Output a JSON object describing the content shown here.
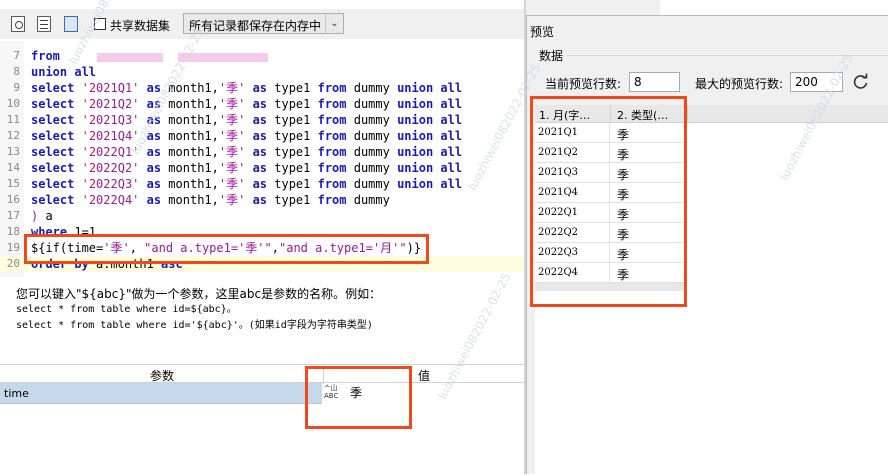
{
  "toolbar": {
    "share_label": "共享数据集",
    "storage_mode": "所有记录都保存在内存中"
  },
  "editor": {
    "lines": [
      {
        "n": "7",
        "parts": [
          [
            "kw",
            "from"
          ],
          [
            "pl",
            " "
          ]
        ]
      },
      {
        "n": "8",
        "parts": [
          [
            "kw",
            "union"
          ],
          [
            "pl",
            " "
          ],
          [
            "kw",
            "all"
          ]
        ]
      },
      {
        "n": "9",
        "parts": [
          [
            "kw",
            "select"
          ],
          [
            "pl",
            " "
          ],
          [
            "str",
            "'2021Q1'"
          ],
          [
            "pl",
            " "
          ],
          [
            "kw",
            "as"
          ],
          [
            "pl",
            " month1,"
          ],
          [
            "str",
            "'季'"
          ],
          [
            "pl",
            " "
          ],
          [
            "kw",
            "as"
          ],
          [
            "pl",
            " type1 "
          ],
          [
            "kw",
            "from"
          ],
          [
            "pl",
            " dummy "
          ],
          [
            "kw",
            "union all"
          ]
        ]
      },
      {
        "n": "10",
        "parts": [
          [
            "kw",
            "select"
          ],
          [
            "pl",
            " "
          ],
          [
            "str",
            "'2021Q2'"
          ],
          [
            "pl",
            " "
          ],
          [
            "kw",
            "as"
          ],
          [
            "pl",
            " month1,"
          ],
          [
            "str",
            "'季'"
          ],
          [
            "pl",
            " "
          ],
          [
            "kw",
            "as"
          ],
          [
            "pl",
            " type1 "
          ],
          [
            "kw",
            "from"
          ],
          [
            "pl",
            " dummy "
          ],
          [
            "kw",
            "union all"
          ]
        ]
      },
      {
        "n": "11",
        "parts": [
          [
            "kw",
            "select"
          ],
          [
            "pl",
            " "
          ],
          [
            "str",
            "'2021Q3'"
          ],
          [
            "pl",
            " "
          ],
          [
            "kw",
            "as"
          ],
          [
            "pl",
            " month1,"
          ],
          [
            "str",
            "'季'"
          ],
          [
            "pl",
            " "
          ],
          [
            "kw",
            "as"
          ],
          [
            "pl",
            " type1 "
          ],
          [
            "kw",
            "from"
          ],
          [
            "pl",
            " dummy "
          ],
          [
            "kw",
            "union all"
          ]
        ]
      },
      {
        "n": "12",
        "parts": [
          [
            "kw",
            "select"
          ],
          [
            "pl",
            " "
          ],
          [
            "str",
            "'2021Q4'"
          ],
          [
            "pl",
            " "
          ],
          [
            "kw",
            "as"
          ],
          [
            "pl",
            " month1,"
          ],
          [
            "str",
            "'季'"
          ],
          [
            "pl",
            " "
          ],
          [
            "kw",
            "as"
          ],
          [
            "pl",
            " type1 "
          ],
          [
            "kw",
            "from"
          ],
          [
            "pl",
            " dummy "
          ],
          [
            "kw",
            "union all"
          ]
        ]
      },
      {
        "n": "13",
        "parts": [
          [
            "kw",
            "select"
          ],
          [
            "pl",
            " "
          ],
          [
            "str",
            "'2022Q1'"
          ],
          [
            "pl",
            " "
          ],
          [
            "kw",
            "as"
          ],
          [
            "pl",
            " month1,"
          ],
          [
            "str",
            "'季'"
          ],
          [
            "pl",
            " "
          ],
          [
            "kw",
            "as"
          ],
          [
            "pl",
            " type1 "
          ],
          [
            "kw",
            "from"
          ],
          [
            "pl",
            " dummy "
          ],
          [
            "kw",
            "union all"
          ]
        ]
      },
      {
        "n": "14",
        "parts": [
          [
            "kw",
            "select"
          ],
          [
            "pl",
            " "
          ],
          [
            "str",
            "'2022Q2'"
          ],
          [
            "pl",
            " "
          ],
          [
            "kw",
            "as"
          ],
          [
            "pl",
            " month1,"
          ],
          [
            "str",
            "'季'"
          ],
          [
            "pl",
            " "
          ],
          [
            "kw",
            "as"
          ],
          [
            "pl",
            " type1 "
          ],
          [
            "kw",
            "from"
          ],
          [
            "pl",
            " dummy "
          ],
          [
            "kw",
            "union all"
          ]
        ]
      },
      {
        "n": "15",
        "parts": [
          [
            "kw",
            "select"
          ],
          [
            "pl",
            " "
          ],
          [
            "str",
            "'2022Q3'"
          ],
          [
            "pl",
            " "
          ],
          [
            "kw",
            "as"
          ],
          [
            "pl",
            " month1,"
          ],
          [
            "str",
            "'季'"
          ],
          [
            "pl",
            " "
          ],
          [
            "kw",
            "as"
          ],
          [
            "pl",
            " type1 "
          ],
          [
            "kw",
            "from"
          ],
          [
            "pl",
            " dummy "
          ],
          [
            "kw",
            "union all"
          ]
        ]
      },
      {
        "n": "16",
        "parts": [
          [
            "kw",
            "select"
          ],
          [
            "pl",
            " "
          ],
          [
            "str",
            "'2022Q4'"
          ],
          [
            "pl",
            " "
          ],
          [
            "kw",
            "as"
          ],
          [
            "pl",
            " month1,"
          ],
          [
            "str",
            "'季'"
          ],
          [
            "pl",
            " "
          ],
          [
            "kw",
            "as"
          ],
          [
            "pl",
            " type1 "
          ],
          [
            "kw",
            "from"
          ],
          [
            "pl",
            " dummy"
          ]
        ]
      },
      {
        "n": "17",
        "parts": [
          [
            "str",
            ")"
          ],
          [
            "pl",
            " a"
          ]
        ]
      },
      {
        "n": "18",
        "parts": [
          [
            "kw",
            "where"
          ],
          [
            "pl",
            " 1=1"
          ]
        ]
      },
      {
        "n": "19",
        "parts": [
          [
            "pl",
            "${if(time="
          ],
          [
            "str",
            "'季'"
          ],
          [
            "pl",
            ", "
          ],
          [
            "str",
            "\"and a.type1='季'\""
          ],
          [
            "pl",
            ","
          ],
          [
            "str",
            "\"and a.type1='月'\""
          ],
          [
            "pl",
            ")}"
          ]
        ]
      },
      {
        "n": "20",
        "parts": [
          [
            "kw",
            "order by"
          ],
          [
            "pl",
            " a.month1 "
          ],
          [
            "kw",
            "asc"
          ]
        ]
      }
    ]
  },
  "hint": {
    "line1": "您可以键入\"${abc}\"做为一个参数，这里abc是参数的名称。例如：",
    "line2": "select * from table where id=${abc}。",
    "line3": "select * from table where id='${abc}'。(如果id字段为字符串类型)"
  },
  "params": {
    "header_param": "参数",
    "header_value": "值",
    "row": {
      "name": "time",
      "type_icon_top": "ᄉ山",
      "type_icon_bottom": "ABC",
      "value": "季"
    }
  },
  "preview": {
    "title": "预览",
    "group": "数据",
    "current_rows_label": "当前预览行数:",
    "current_rows_value": "8",
    "max_rows_label": "最大的预览行数:",
    "max_rows_value": "200",
    "refresh_icon": "refresh-icon",
    "grid": {
      "columns": [
        "1. 月(字…",
        "2. 类型(…"
      ],
      "rows": [
        {
          "month": "2021Q1",
          "type": "季"
        },
        {
          "month": "2021Q2",
          "type": "季"
        },
        {
          "month": "2021Q3",
          "type": "季"
        },
        {
          "month": "2021Q4",
          "type": "季"
        },
        {
          "month": "2022Q1",
          "type": "季"
        },
        {
          "month": "2022Q2",
          "type": "季"
        },
        {
          "month": "2022Q3",
          "type": "季"
        },
        {
          "month": "2022Q4",
          "type": "季"
        }
      ]
    }
  },
  "watermark": "luozhiwei082022-02-25",
  "colors": {
    "highlight_frame": "#ee4a1a",
    "keyword": "#1a1ab8",
    "string": "#9a1a9a"
  }
}
